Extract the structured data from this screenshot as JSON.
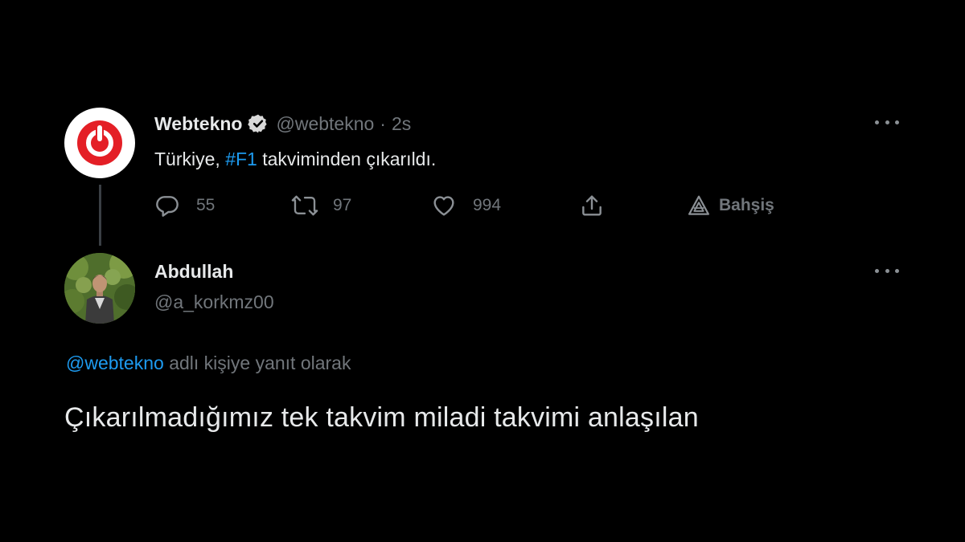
{
  "original_tweet": {
    "display_name": "Webtekno",
    "handle": "@webtekno",
    "separator": "·",
    "time": "2s",
    "text_before": "Türkiye, ",
    "hashtag": "#F1",
    "text_after": " takviminden çıkarıldı.",
    "reply_count": "55",
    "retweet_count": "97",
    "like_count": "994",
    "tip_label": "Bahşiş"
  },
  "reply_tweet": {
    "display_name": "Abdullah",
    "handle": "@a_korkmz00",
    "replying_to_handle": "@webtekno",
    "replying_to_suffix": " adlı kişiye yanıt olarak",
    "text": "Çıkarılmadığımız tek takvim miladi takvimi anlaşılan"
  },
  "icons": {
    "avatar_logo": "power-icon",
    "verified": "verified-badge-icon",
    "reply": "reply-icon",
    "retweet": "retweet-icon",
    "like": "heart-icon",
    "share": "share-icon",
    "tip": "tip-icon",
    "more": "more-icon"
  },
  "colors": {
    "background": "#000000",
    "brand_red": "#e41f26",
    "link_blue": "#1d9bf0",
    "muted": "#71767b",
    "text": "#e7e9ea"
  }
}
